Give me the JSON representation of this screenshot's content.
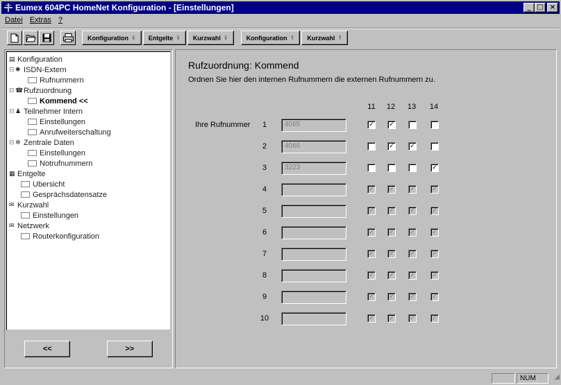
{
  "window": {
    "title": "Eumex 604PC HomeNet Konfiguration - [Einstellungen]",
    "controls": [
      "_",
      "□",
      "×"
    ]
  },
  "menubar": [
    {
      "label": "Datei",
      "accel": "D"
    },
    {
      "label": "Extras",
      "accel": "E"
    },
    {
      "label": "?",
      "accel": "?"
    }
  ],
  "toolbar": {
    "icons": [
      "new-doc-icon",
      "open-folder-icon",
      "save-disk-icon",
      "printer-icon"
    ],
    "buttons": [
      {
        "label": "Konfiguration",
        "arrow": "down"
      },
      {
        "label": "Entgelte",
        "arrow": "down"
      },
      {
        "label": "Kurzwahl",
        "arrow": "down"
      },
      {
        "label": "Konfiguration",
        "arrow": "up"
      },
      {
        "label": "Kurzwahl",
        "arrow": "up"
      }
    ]
  },
  "tree": {
    "items": [
      {
        "label": "Konfiguration",
        "level": 0,
        "icon": "config-icon"
      },
      {
        "label": "ISDN-Extern",
        "level": 1,
        "icon": "isdn-icon"
      },
      {
        "label": "Rufnummern",
        "level": 2
      },
      {
        "label": "Rufzuordnung",
        "level": 1,
        "icon": "phone-icon"
      },
      {
        "label": "Kommend <<",
        "level": 2,
        "selected": true
      },
      {
        "label": "Teilnehmer Intern",
        "level": 1,
        "icon": "user-icon"
      },
      {
        "label": "Einstellungen",
        "level": 2
      },
      {
        "label": "Anrufweiterschaltung",
        "level": 2
      },
      {
        "label": "Zentrale Daten",
        "level": 1,
        "icon": "central-icon"
      },
      {
        "label": "Einstellungen",
        "level": 2
      },
      {
        "label": "Notrufnummern",
        "level": 2
      },
      {
        "label": "Entgelte",
        "level": 0,
        "icon": "fees-icon"
      },
      {
        "label": "Ubersicht",
        "level": 2
      },
      {
        "label": "Gesprächsdatensatze",
        "level": 2
      },
      {
        "label": "Kurzwahl",
        "level": 0,
        "icon": "speed-dial-icon"
      },
      {
        "label": "Einstellungen",
        "level": 2
      },
      {
        "label": "Netzwerk",
        "level": 0,
        "icon": "network-icon"
      },
      {
        "label": "Routerkonfiguration",
        "level": 2
      }
    ],
    "prev_label": "<<",
    "next_label": ">>"
  },
  "main": {
    "title": "Rufzuordnung: Kommend",
    "description": "Ordnen Sie hier den internen Rufnummern die externen Rufnummern zu.",
    "row_label": "Ihre Rufnummer",
    "columns": [
      "11",
      "12",
      "13",
      "14"
    ],
    "rows": [
      {
        "index": "1",
        "number": "4065",
        "checks": [
          true,
          true,
          false,
          false
        ],
        "enabled": true
      },
      {
        "index": "2",
        "number": "4066",
        "checks": [
          false,
          true,
          true,
          false
        ],
        "enabled": true
      },
      {
        "index": "3",
        "number": "3223",
        "checks": [
          false,
          false,
          false,
          true
        ],
        "enabled": true
      },
      {
        "index": "4",
        "number": "",
        "checks": [
          true,
          true,
          true,
          true
        ],
        "enabled": false
      },
      {
        "index": "5",
        "number": "",
        "checks": [
          true,
          true,
          true,
          true
        ],
        "enabled": false
      },
      {
        "index": "6",
        "number": "",
        "checks": [
          true,
          true,
          true,
          true
        ],
        "enabled": false
      },
      {
        "index": "7",
        "number": "",
        "checks": [
          true,
          true,
          true,
          true
        ],
        "enabled": false
      },
      {
        "index": "8",
        "number": "",
        "checks": [
          true,
          true,
          true,
          true
        ],
        "enabled": false
      },
      {
        "index": "9",
        "number": "",
        "checks": [
          true,
          true,
          true,
          true
        ],
        "enabled": false
      },
      {
        "index": "10",
        "number": "",
        "checks": [
          true,
          true,
          true,
          true
        ],
        "enabled": false
      }
    ]
  },
  "statusbar": {
    "num_indicator": "NUM"
  }
}
